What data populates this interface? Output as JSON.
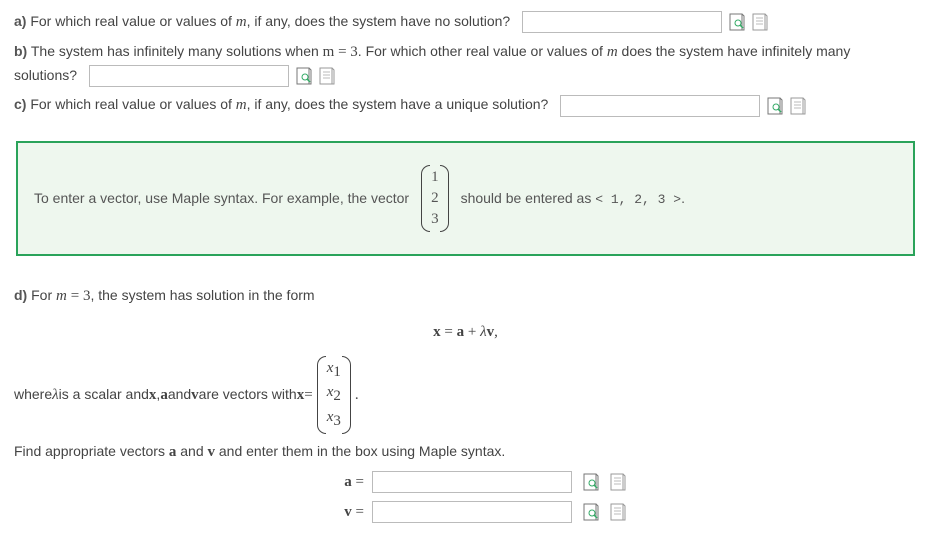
{
  "a": {
    "label": "a)",
    "text": " For which real value or values of ",
    "var": "m",
    "text2": ", if any, does the system have no solution?"
  },
  "b": {
    "label": "b)",
    "text1": " The system has infinitely many solutions when ",
    "eq": "m = 3",
    "text2": ". For which other real value or values of ",
    "var": "m",
    "text3": " does the system have infinitely many solutions?"
  },
  "c": {
    "label": "c)",
    "text": " For which real value or values of ",
    "var": "m",
    "text2": ", if any, does the system have a unique solution?"
  },
  "hint": {
    "pre": "To enter a vector, use Maple syntax.  For example, the vector",
    "v1": "1",
    "v2": "2",
    "v3": "3",
    "post1": "should be entered as ",
    "code": "< 1, 2, 3 >",
    "post2": "."
  },
  "d": {
    "label": "d)",
    "text1": " For ",
    "eq": "m = 3",
    "text2": ", the system has solution in the form",
    "eqline_x": "x",
    "eqline_eq": " = ",
    "eqline_a": "a",
    "eqline_plus": " + ",
    "eqline_lam": "λ",
    "eqline_v": "v",
    "eqline_comma": ",",
    "where1": "where ",
    "lam": "λ",
    "where2": " is a scalar and ",
    "xbf": "x",
    "abf": "a",
    "vbf": "v",
    "comma": ", ",
    "and": " and ",
    "where3": " are vectors with ",
    "xeq": "x",
    "eqsym": " = ",
    "x1": "x",
    "s1": "1",
    "x2": "x",
    "s2": "2",
    "x3": "x",
    "s3": "3",
    "dot": " .",
    "find": "Find appropriate vectors ",
    "find_and": " and ",
    "find2": " and enter them in the box using Maple syntax.",
    "alhs": "a =",
    "vlhs": "v ="
  }
}
